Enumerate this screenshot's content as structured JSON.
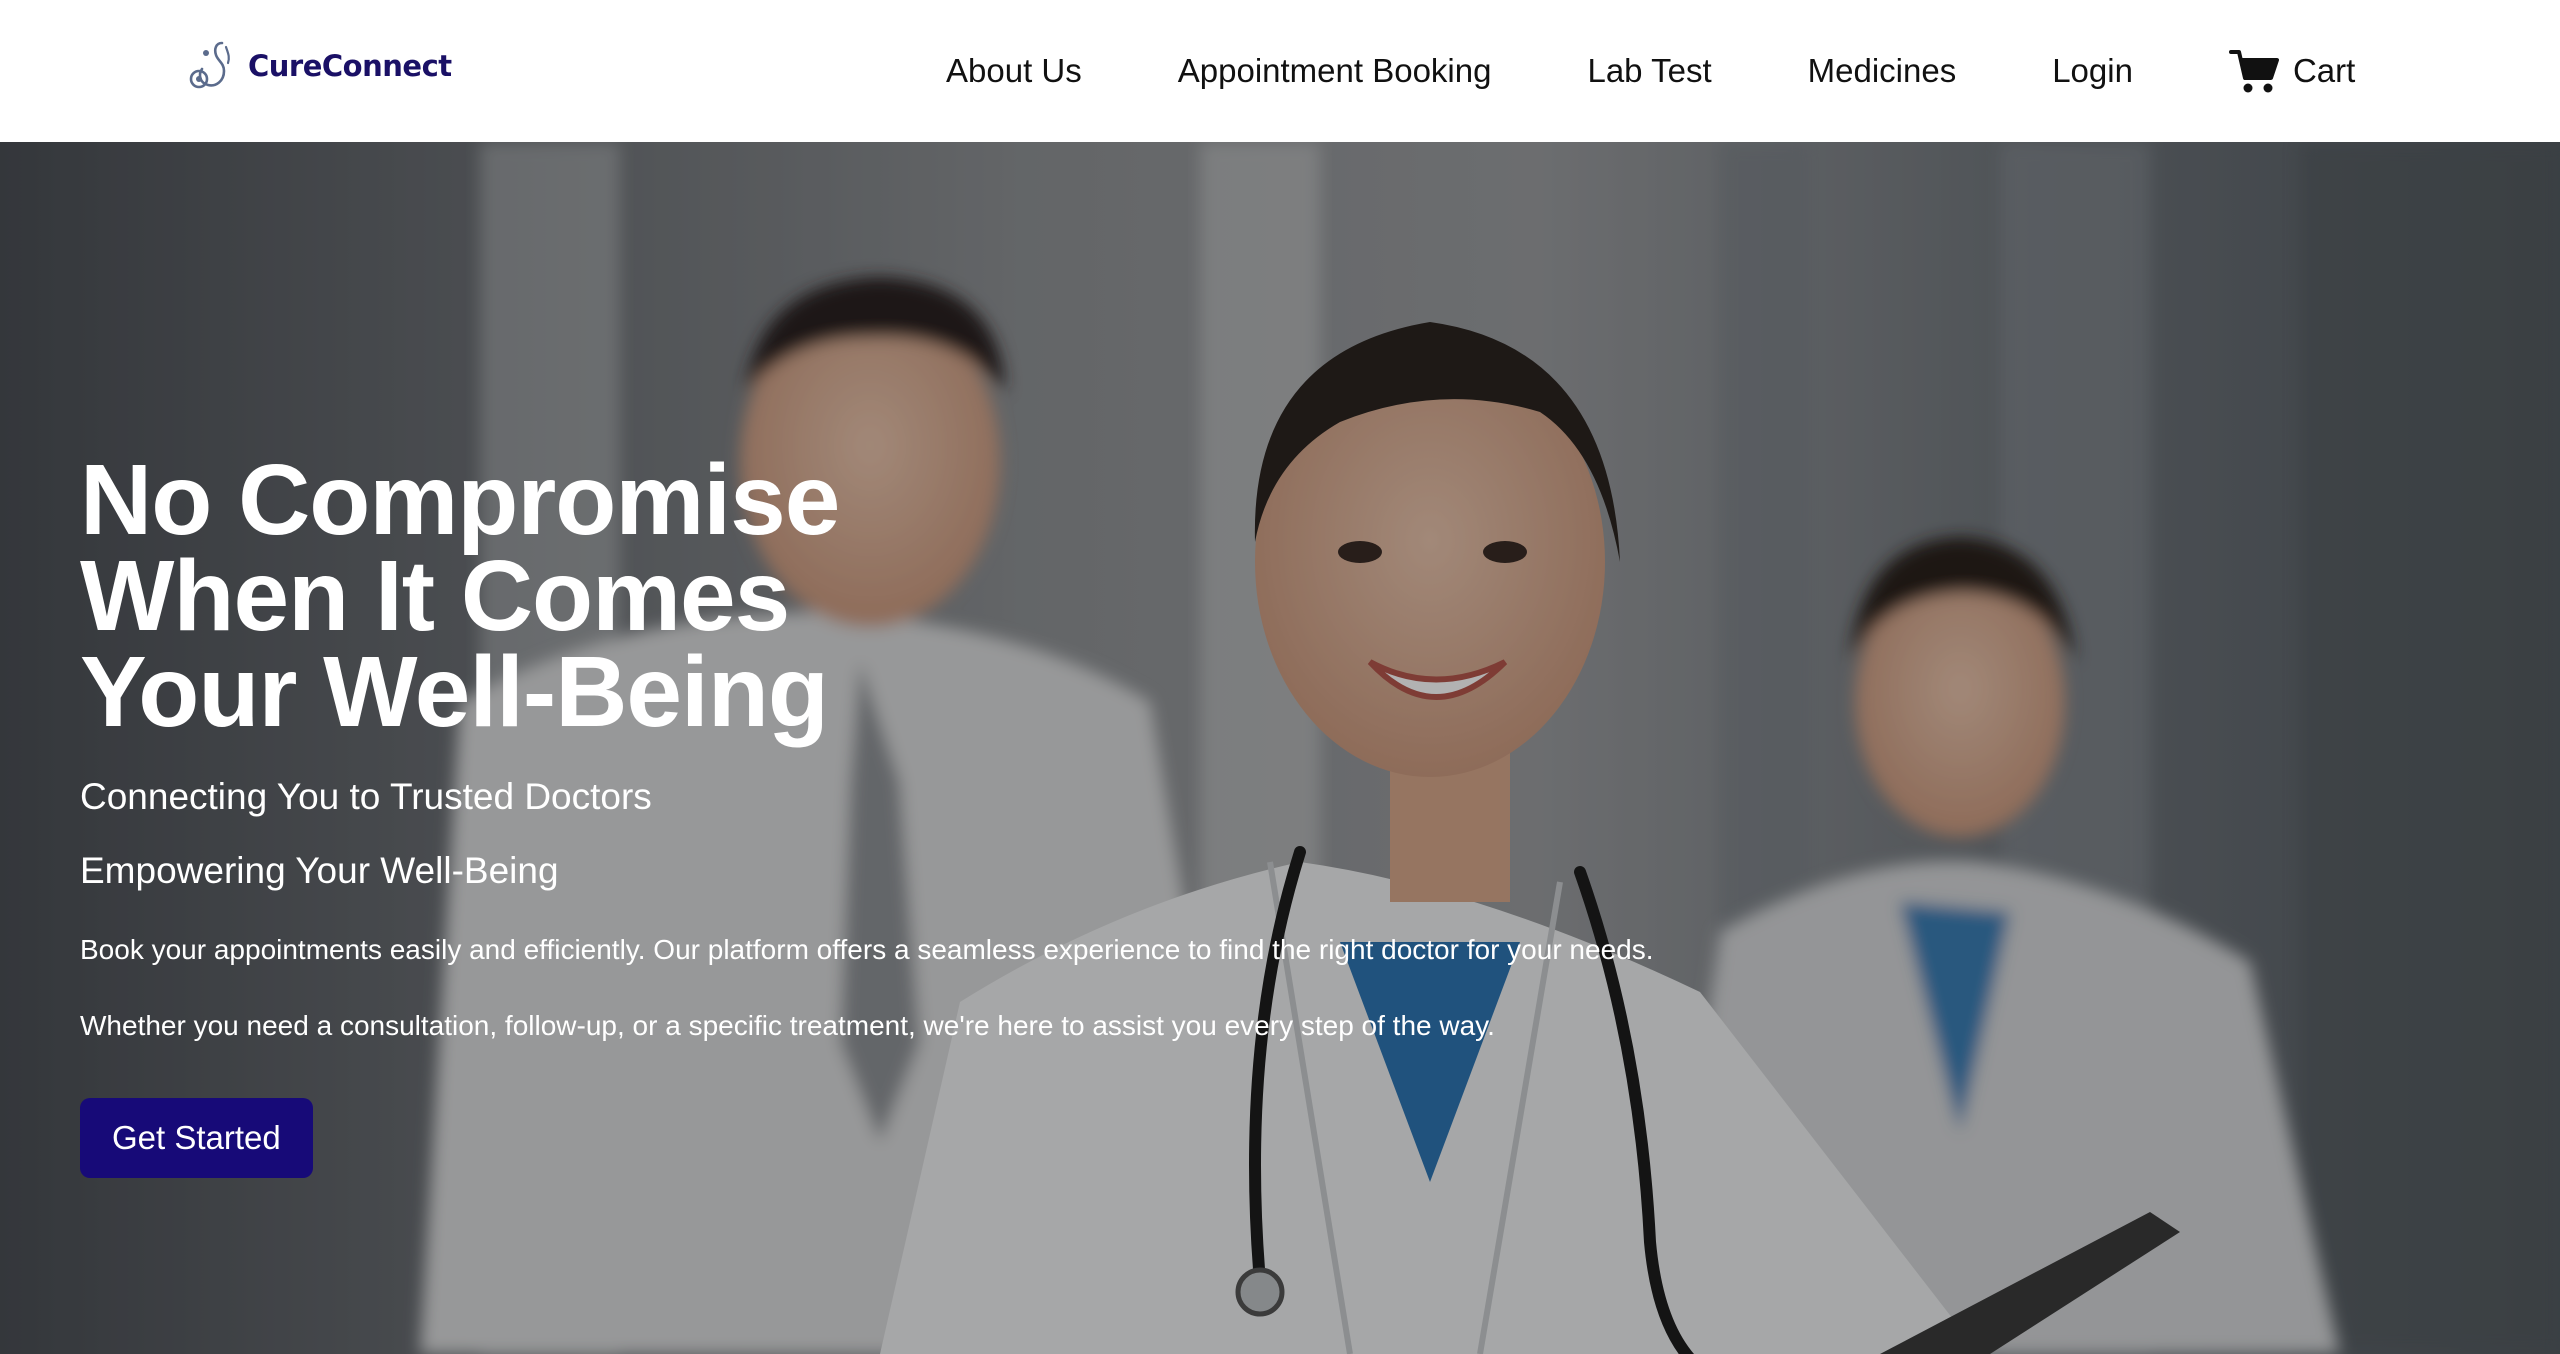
{
  "brand": {
    "name": "CureConnect",
    "logo_icon": "stethoscope-icon",
    "color": "#1a1066"
  },
  "nav": {
    "items": [
      {
        "label": "About Us"
      },
      {
        "label": "Appointment Booking"
      },
      {
        "label": "Lab Test"
      },
      {
        "label": "Medicines"
      },
      {
        "label": "Login"
      }
    ],
    "cart": {
      "label": "Cart",
      "icon": "cart-icon"
    }
  },
  "hero": {
    "title": "No Compromise When It Comes Your Well-Being",
    "subtitle_1": "Connecting You to Trusted Doctors",
    "subtitle_2": "Empowering Your Well-Being",
    "paragraph_1": "Book your appointments easily and efficiently. Our platform offers a seamless experience to find the right doctor for your needs.",
    "paragraph_2": "Whether you need a consultation, follow-up, or a specific treatment, we're here to assist you every step of the way.",
    "cta_label": "Get Started",
    "cta_color": "#170a78"
  }
}
